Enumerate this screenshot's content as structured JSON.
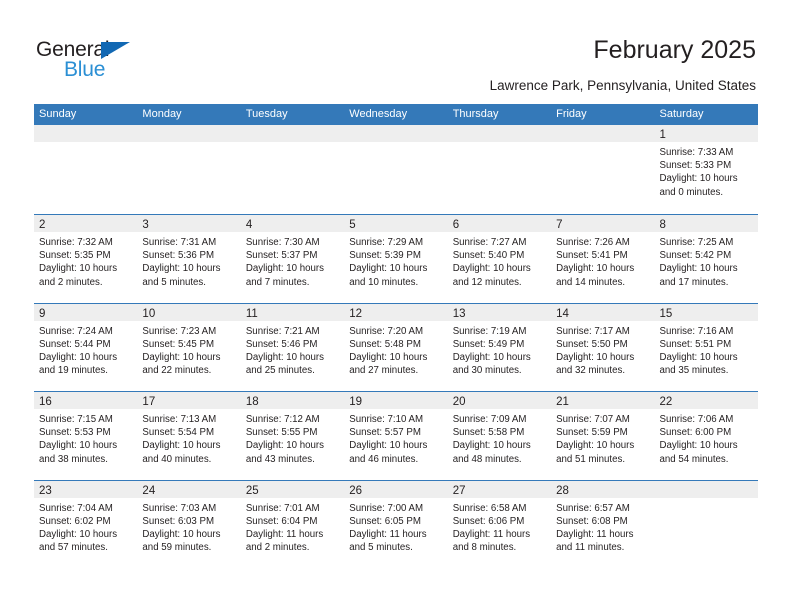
{
  "brand": {
    "name_top": "General",
    "name_bottom": "Blue",
    "triangle_color": "#1268b3",
    "blue_text_color": "#2b8fd4"
  },
  "header": {
    "title": "February 2025",
    "subtitle": "Lawrence Park, Pennsylvania, United States"
  },
  "theme": {
    "header_blue": "#3479b9",
    "date_band_gray": "#eeeeee",
    "text_color": "#231f20"
  },
  "calendar": {
    "weekday_headers": [
      "Sunday",
      "Monday",
      "Tuesday",
      "Wednesday",
      "Thursday",
      "Friday",
      "Saturday"
    ],
    "weeks": [
      [
        {
          "day": "",
          "lines": []
        },
        {
          "day": "",
          "lines": []
        },
        {
          "day": "",
          "lines": []
        },
        {
          "day": "",
          "lines": []
        },
        {
          "day": "",
          "lines": []
        },
        {
          "day": "",
          "lines": []
        },
        {
          "day": "1",
          "lines": [
            "Sunrise: 7:33 AM",
            "Sunset: 5:33 PM",
            "Daylight: 10 hours",
            "and 0 minutes."
          ]
        }
      ],
      [
        {
          "day": "2",
          "lines": [
            "Sunrise: 7:32 AM",
            "Sunset: 5:35 PM",
            "Daylight: 10 hours",
            "and 2 minutes."
          ]
        },
        {
          "day": "3",
          "lines": [
            "Sunrise: 7:31 AM",
            "Sunset: 5:36 PM",
            "Daylight: 10 hours",
            "and 5 minutes."
          ]
        },
        {
          "day": "4",
          "lines": [
            "Sunrise: 7:30 AM",
            "Sunset: 5:37 PM",
            "Daylight: 10 hours",
            "and 7 minutes."
          ]
        },
        {
          "day": "5",
          "lines": [
            "Sunrise: 7:29 AM",
            "Sunset: 5:39 PM",
            "Daylight: 10 hours",
            "and 10 minutes."
          ]
        },
        {
          "day": "6",
          "lines": [
            "Sunrise: 7:27 AM",
            "Sunset: 5:40 PM",
            "Daylight: 10 hours",
            "and 12 minutes."
          ]
        },
        {
          "day": "7",
          "lines": [
            "Sunrise: 7:26 AM",
            "Sunset: 5:41 PM",
            "Daylight: 10 hours",
            "and 14 minutes."
          ]
        },
        {
          "day": "8",
          "lines": [
            "Sunrise: 7:25 AM",
            "Sunset: 5:42 PM",
            "Daylight: 10 hours",
            "and 17 minutes."
          ]
        }
      ],
      [
        {
          "day": "9",
          "lines": [
            "Sunrise: 7:24 AM",
            "Sunset: 5:44 PM",
            "Daylight: 10 hours",
            "and 19 minutes."
          ]
        },
        {
          "day": "10",
          "lines": [
            "Sunrise: 7:23 AM",
            "Sunset: 5:45 PM",
            "Daylight: 10 hours",
            "and 22 minutes."
          ]
        },
        {
          "day": "11",
          "lines": [
            "Sunrise: 7:21 AM",
            "Sunset: 5:46 PM",
            "Daylight: 10 hours",
            "and 25 minutes."
          ]
        },
        {
          "day": "12",
          "lines": [
            "Sunrise: 7:20 AM",
            "Sunset: 5:48 PM",
            "Daylight: 10 hours",
            "and 27 minutes."
          ]
        },
        {
          "day": "13",
          "lines": [
            "Sunrise: 7:19 AM",
            "Sunset: 5:49 PM",
            "Daylight: 10 hours",
            "and 30 minutes."
          ]
        },
        {
          "day": "14",
          "lines": [
            "Sunrise: 7:17 AM",
            "Sunset: 5:50 PM",
            "Daylight: 10 hours",
            "and 32 minutes."
          ]
        },
        {
          "day": "15",
          "lines": [
            "Sunrise: 7:16 AM",
            "Sunset: 5:51 PM",
            "Daylight: 10 hours",
            "and 35 minutes."
          ]
        }
      ],
      [
        {
          "day": "16",
          "lines": [
            "Sunrise: 7:15 AM",
            "Sunset: 5:53 PM",
            "Daylight: 10 hours",
            "and 38 minutes."
          ]
        },
        {
          "day": "17",
          "lines": [
            "Sunrise: 7:13 AM",
            "Sunset: 5:54 PM",
            "Daylight: 10 hours",
            "and 40 minutes."
          ]
        },
        {
          "day": "18",
          "lines": [
            "Sunrise: 7:12 AM",
            "Sunset: 5:55 PM",
            "Daylight: 10 hours",
            "and 43 minutes."
          ]
        },
        {
          "day": "19",
          "lines": [
            "Sunrise: 7:10 AM",
            "Sunset: 5:57 PM",
            "Daylight: 10 hours",
            "and 46 minutes."
          ]
        },
        {
          "day": "20",
          "lines": [
            "Sunrise: 7:09 AM",
            "Sunset: 5:58 PM",
            "Daylight: 10 hours",
            "and 48 minutes."
          ]
        },
        {
          "day": "21",
          "lines": [
            "Sunrise: 7:07 AM",
            "Sunset: 5:59 PM",
            "Daylight: 10 hours",
            "and 51 minutes."
          ]
        },
        {
          "day": "22",
          "lines": [
            "Sunrise: 7:06 AM",
            "Sunset: 6:00 PM",
            "Daylight: 10 hours",
            "and 54 minutes."
          ]
        }
      ],
      [
        {
          "day": "23",
          "lines": [
            "Sunrise: 7:04 AM",
            "Sunset: 6:02 PM",
            "Daylight: 10 hours",
            "and 57 minutes."
          ]
        },
        {
          "day": "24",
          "lines": [
            "Sunrise: 7:03 AM",
            "Sunset: 6:03 PM",
            "Daylight: 10 hours",
            "and 59 minutes."
          ]
        },
        {
          "day": "25",
          "lines": [
            "Sunrise: 7:01 AM",
            "Sunset: 6:04 PM",
            "Daylight: 11 hours",
            "and 2 minutes."
          ]
        },
        {
          "day": "26",
          "lines": [
            "Sunrise: 7:00 AM",
            "Sunset: 6:05 PM",
            "Daylight: 11 hours",
            "and 5 minutes."
          ]
        },
        {
          "day": "27",
          "lines": [
            "Sunrise: 6:58 AM",
            "Sunset: 6:06 PM",
            "Daylight: 11 hours",
            "and 8 minutes."
          ]
        },
        {
          "day": "28",
          "lines": [
            "Sunrise: 6:57 AM",
            "Sunset: 6:08 PM",
            "Daylight: 11 hours",
            "and 11 minutes."
          ]
        },
        {
          "day": "",
          "lines": []
        }
      ]
    ]
  }
}
